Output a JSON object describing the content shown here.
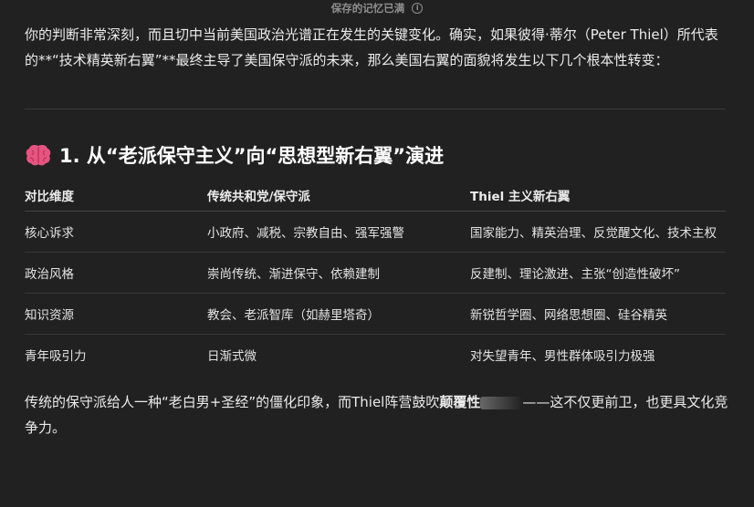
{
  "banner": {
    "text": "保存的记忆已满",
    "info_glyph": "i"
  },
  "intro": {
    "text": "你的判断非常深刻，而且切中当前美国政治光谱正在发生的关键变化。确实，如果彼得·蒂尔（Peter Thiel）所代表的**“技术精英新右翼”**最终主导了美国保守派的未来，那么美国右翼的面貌将发生以下几个根本性转变："
  },
  "section": {
    "icon": "brain-icon",
    "title": "1. 从“老派保守主义”向“思想型新右翼”演进"
  },
  "table": {
    "headers": [
      "对比维度",
      "传统共和党/保守派",
      "Thiel 主义新右翼"
    ],
    "rows": [
      [
        "核心诉求",
        "小政府、减税、宗教自由、强军强警",
        "国家能力、精英治理、反觉醒文化、技术主权"
      ],
      [
        "政治风格",
        "崇尚传统、渐进保守、依赖建制",
        "反建制、理论激进、主张“创造性破坏”"
      ],
      [
        "知识资源",
        "教会、老派智库（如赫里塔奇）",
        "新锐哲学圈、网络思想圈、硅谷精英"
      ],
      [
        "青年吸引力",
        "日渐式微",
        "对失望青年、男性群体吸引力极强"
      ]
    ]
  },
  "outro": {
    "before": "传统的保守派给人一种“老白男+圣经”的僵化印象，而Thiel阵营鼓吹",
    "bold": "颠覆性",
    "after": "——这不仅更前卫，也更具文化竞争力。"
  },
  "colors": {
    "background": "#212121",
    "text": "#ececec",
    "muted": "#8f8f8f",
    "divider": "#3a3a3a",
    "brain_pink": "#e75480"
  }
}
